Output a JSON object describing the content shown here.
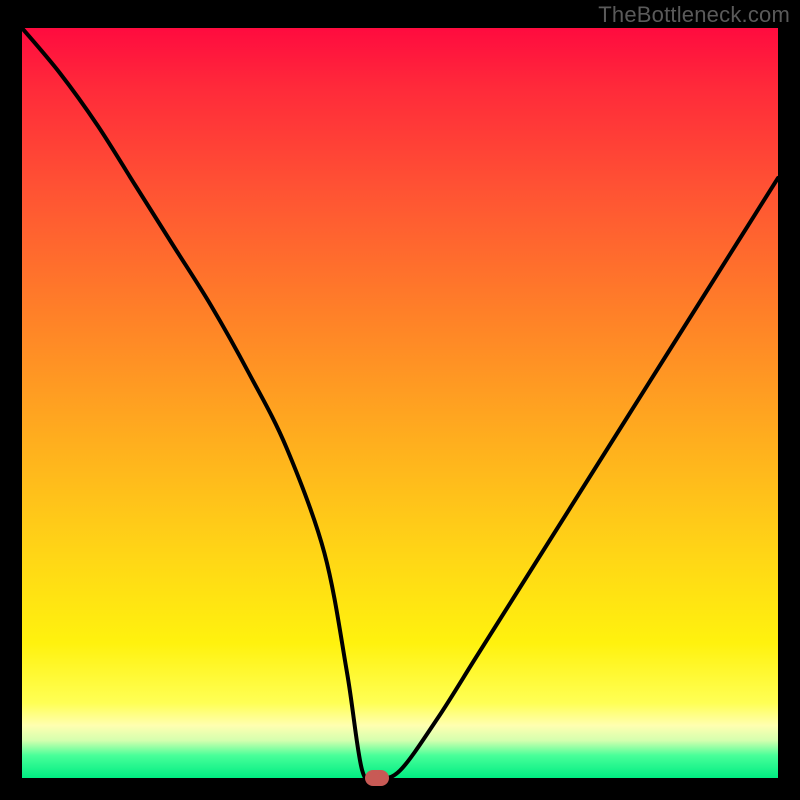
{
  "watermark": "TheBottleneck.com",
  "chart_data": {
    "type": "line",
    "title": "",
    "xlabel": "",
    "ylabel": "",
    "xlim": [
      0,
      100
    ],
    "ylim": [
      0,
      100
    ],
    "x": [
      0,
      5,
      10,
      15,
      20,
      25,
      30,
      35,
      40,
      43,
      45,
      47,
      50,
      55,
      60,
      65,
      70,
      75,
      80,
      85,
      90,
      95,
      100
    ],
    "values": [
      100,
      94,
      87,
      79,
      71,
      63,
      54,
      44,
      30,
      14,
      1,
      0,
      1,
      8,
      16,
      24,
      32,
      40,
      48,
      56,
      64,
      72,
      80
    ],
    "background_gradient": {
      "type": "vertical",
      "stops": [
        {
          "pos": 0.0,
          "color": "#ff0b3f"
        },
        {
          "pos": 0.22,
          "color": "#ff5433"
        },
        {
          "pos": 0.55,
          "color": "#ffae1e"
        },
        {
          "pos": 0.82,
          "color": "#fff20e"
        },
        {
          "pos": 0.95,
          "color": "#d4ffaf"
        },
        {
          "pos": 1.0,
          "color": "#00ec82"
        }
      ]
    },
    "marker": {
      "x": 47,
      "y": 0,
      "color": "#c85a55"
    },
    "curve_stroke": "#000000",
    "curve_width": 4
  }
}
